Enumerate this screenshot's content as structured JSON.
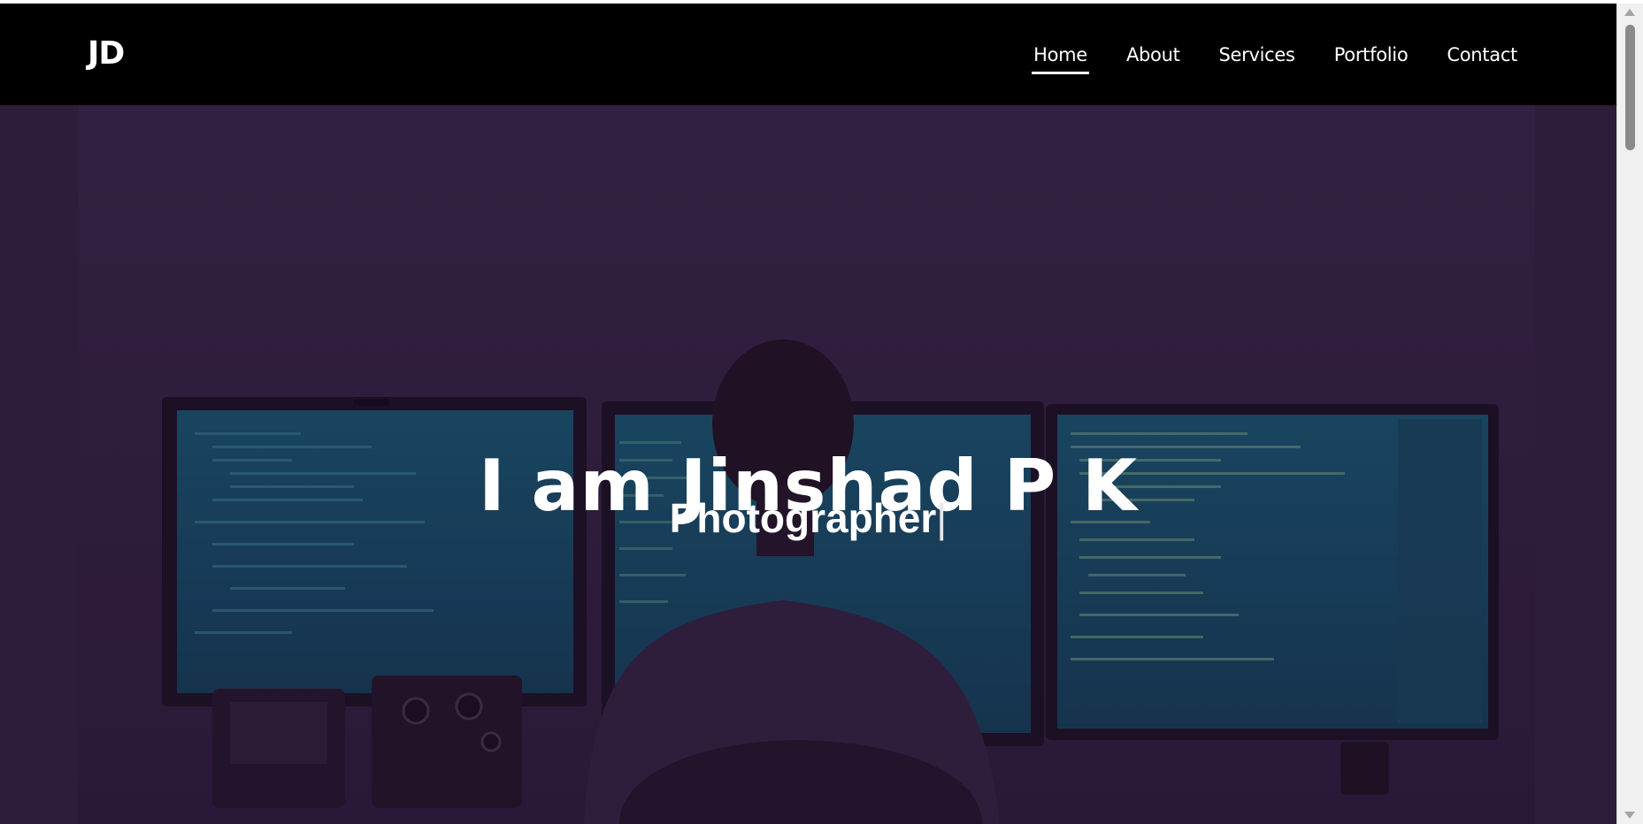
{
  "logo": "JD",
  "nav": {
    "items": [
      {
        "label": "Home",
        "active": true
      },
      {
        "label": "About",
        "active": false
      },
      {
        "label": "Services",
        "active": false
      },
      {
        "label": "Portfolio",
        "active": false
      },
      {
        "label": "Contact",
        "active": false
      }
    ]
  },
  "hero": {
    "title": "I am Jinshad P K",
    "subtitle": "Photographer",
    "cursor": "|"
  },
  "colors": {
    "navbar_bg": "#000000",
    "text": "#ffffff",
    "hero_tint": "#2b2038",
    "screen_glow": "#0b5a6a"
  }
}
